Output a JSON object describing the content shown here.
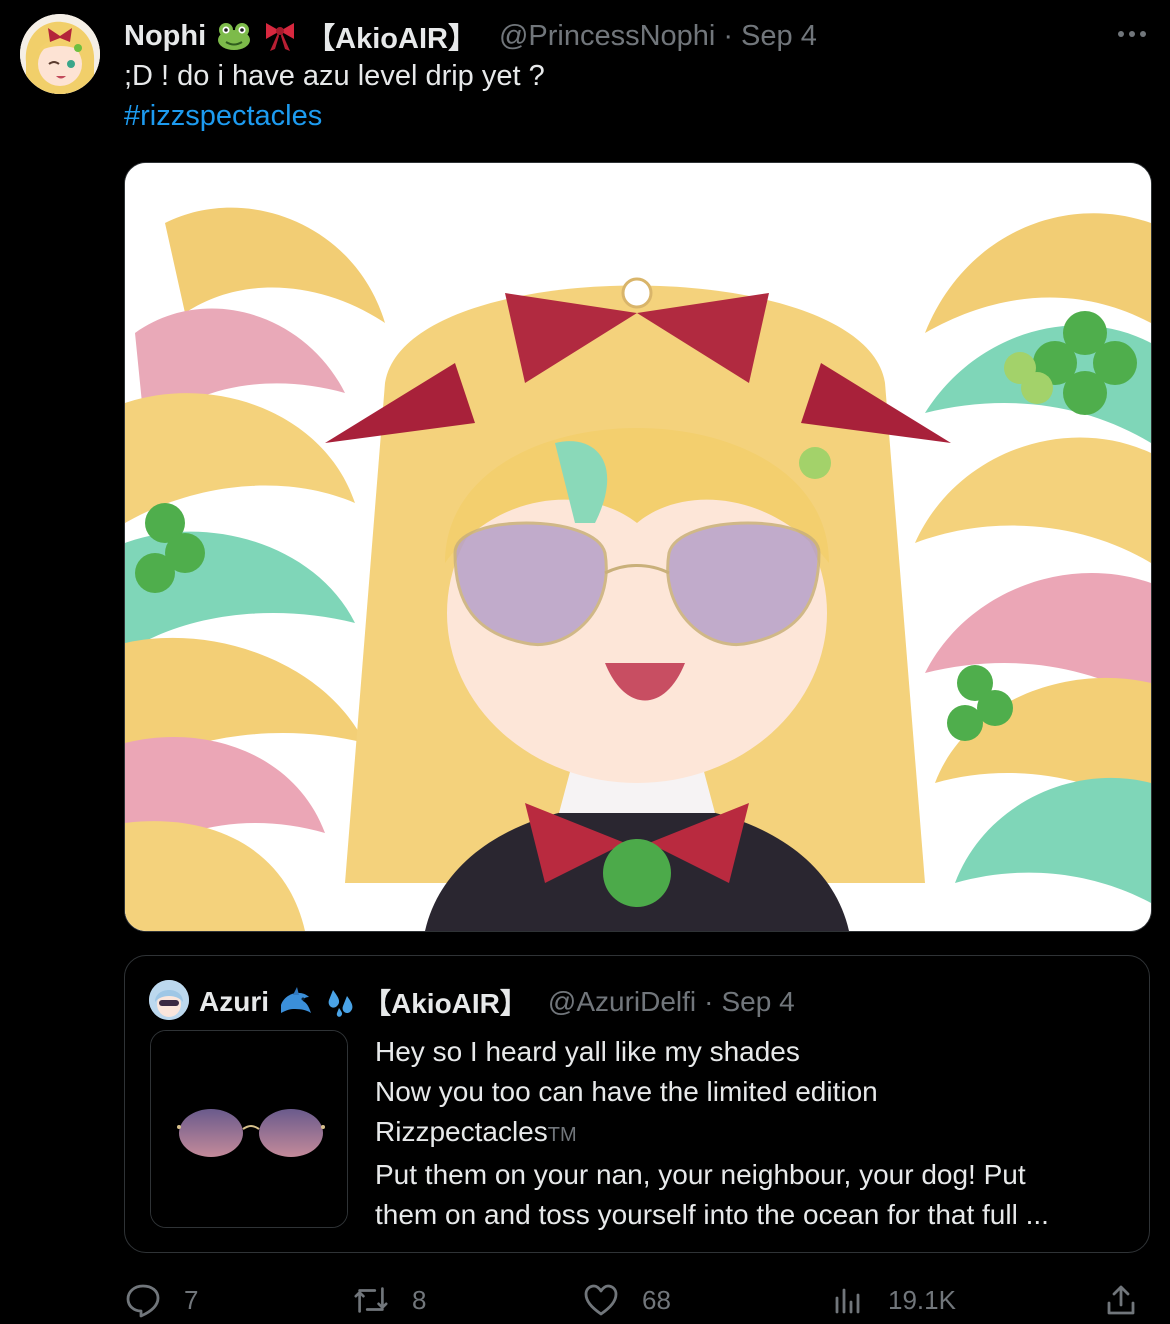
{
  "tweet": {
    "author": {
      "display_name": "Nophi",
      "emoji_1": "frog-emoji",
      "emoji_2": "ribbon-emoji",
      "affiliation": "【AkioAIR】",
      "handle": "@PrincessNophi",
      "separator": "·",
      "date": "Sep 4"
    },
    "text": ";D ! do i have azu level drip yet ?",
    "hashtag": "#rizzspectacles",
    "media": {
      "description_icon": "anime-illustration-image"
    }
  },
  "quote": {
    "author": {
      "display_name": "Azuri",
      "emoji_1": "dolphin-emoji",
      "emoji_2": "sweat-droplets-emoji",
      "affiliation": "【AkioAIR】",
      "handle": "@AzuriDelfi",
      "separator": "·",
      "date": "Sep 4"
    },
    "lines": [
      "Hey so I heard yall like my shades",
      "Now you too can have the limited edition",
      "Rizzpectacles",
      "Put them on your nan, your neighbour, your dog! Put",
      "them on and toss yourself into the ocean for that full ..."
    ],
    "tm": "TM"
  },
  "actions": {
    "replies": "7",
    "retweets": "8",
    "likes": "68",
    "views": "19.1K"
  },
  "colors": {
    "background": "#000000",
    "text": "#e7e9ea",
    "secondary": "#71767b",
    "link": "#1d9bf0",
    "border": "#2f3336"
  }
}
